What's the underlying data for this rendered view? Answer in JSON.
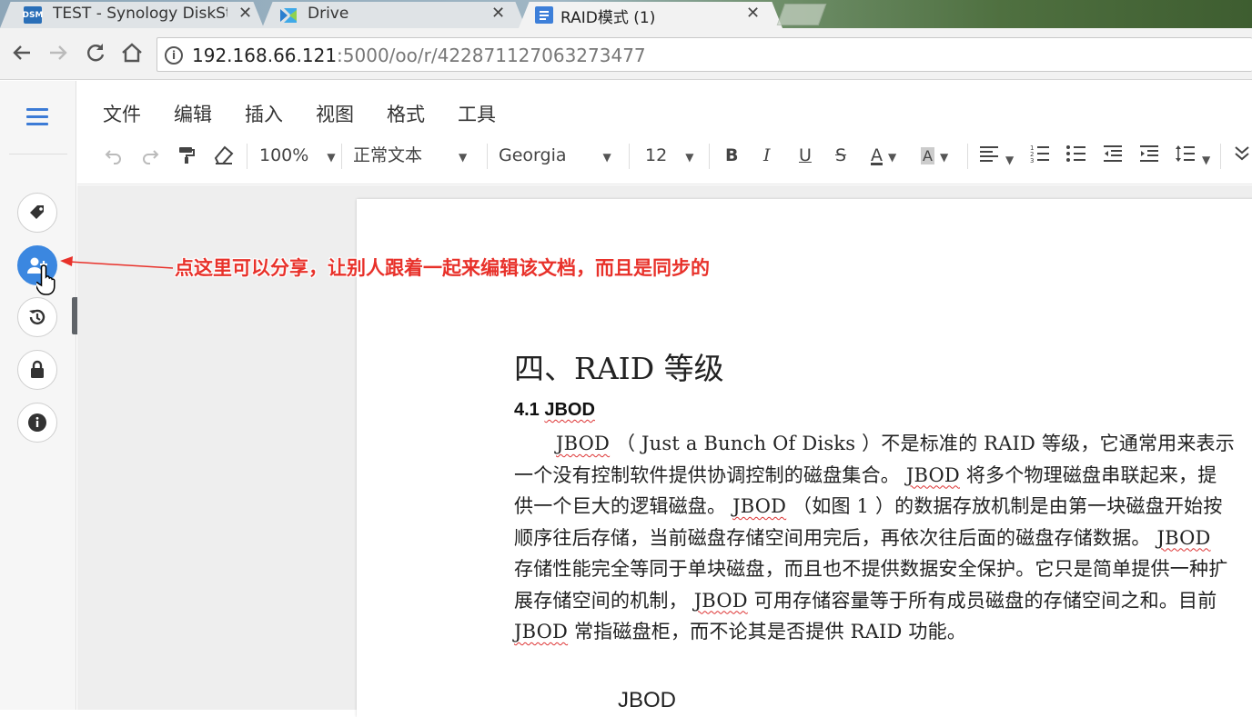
{
  "browser": {
    "tabs": [
      {
        "title": "TEST - Synology DiskSt",
        "favicon": "DSM",
        "active": false
      },
      {
        "title": "Drive",
        "favicon": "drive-icon",
        "active": false
      },
      {
        "title": "RAID模式 (1)",
        "favicon": "doc-icon",
        "active": true
      }
    ],
    "close_glyph": "✕",
    "url_host": "192.168.66.121",
    "url_rest": ":5000/oo/r/422871127063273477",
    "info_glyph": "i"
  },
  "menubar": {
    "items": [
      "文件",
      "编辑",
      "插入",
      "视图",
      "格式",
      "工具"
    ]
  },
  "format_toolbar": {
    "zoom": "100%",
    "paragraph_style": "正常文本",
    "font": "Georgia",
    "font_size": "12",
    "bold": "B",
    "italic": "I",
    "underline": "U",
    "strike": "S",
    "text_color": "A",
    "highlight": "A"
  },
  "sidebar": {
    "tooltip": "分享"
  },
  "annotation": {
    "text": "点这里可以分享，让别人跟着一起来编辑该文档，而且是同步的"
  },
  "document": {
    "heading": "四、RAID 等级",
    "subheading_num": "4.1 ",
    "subheading_word": "JBOD",
    "body": [
      {
        "t": "JBOD",
        "s": true
      },
      {
        "t": " （ Just a Bunch Of Disks ）不是标准的 RAID 等级，它通常用来表示一个没有控制软件提供协调控制的磁盘集合。 ",
        "s": false
      },
      {
        "t": "JBOD",
        "s": true
      },
      {
        "t": " 将多个物理磁盘串联起来，提供一个巨大的逻辑磁盘。 ",
        "s": false
      },
      {
        "t": "JBOD",
        "s": true
      },
      {
        "t": " （如图 1 ）的数据存放机制是由第一块磁盘开始按顺序往后存储，当前磁盘存储空间用完后，再依次往后面的磁盘存储数据。 ",
        "s": false
      },
      {
        "t": "JBOD",
        "s": true
      },
      {
        "t": " 存储性能完全等同于单块磁盘，而且也不提供数据安全保护。它只是简单提供一种扩展存储空间的机制， ",
        "s": false
      },
      {
        "t": "JBOD",
        "s": true
      },
      {
        "t": " 可用存储容量等于所有成员磁盘的存储空间之和。目前 ",
        "s": false
      },
      {
        "t": "JBOD",
        "s": true
      },
      {
        "t": " 常指磁盘柜，而不论其是否提供 RAID 功能。",
        "s": false
      }
    ],
    "figure_label": "JBOD"
  },
  "colors": {
    "accent": "#3b87e0",
    "annotation": "#e8312a",
    "spellcheck": "#d33"
  }
}
